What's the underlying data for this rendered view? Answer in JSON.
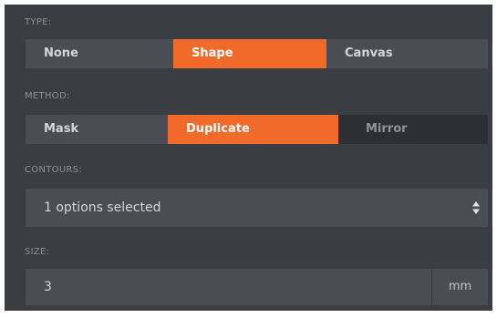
{
  "type_section": {
    "label": "TYPE:",
    "options": [
      "None",
      "Shape",
      "Canvas"
    ],
    "selected": "Shape"
  },
  "method_section": {
    "label": "METHOD:",
    "options": [
      "Mask",
      "Duplicate",
      "Mirror"
    ],
    "selected": "Duplicate"
  },
  "contours_section": {
    "label": "CONTOURS:",
    "value": "1 options selected",
    "arrows_icon": "up-down-arrows-icon"
  },
  "size_section": {
    "label": "SIZE:",
    "value": "3",
    "unit": "mm"
  },
  "colors": {
    "panel_bg": "#3a3d42",
    "control_bg": "#4a4e54",
    "accent": "#f26a2a",
    "label_text": "#8d9096"
  }
}
